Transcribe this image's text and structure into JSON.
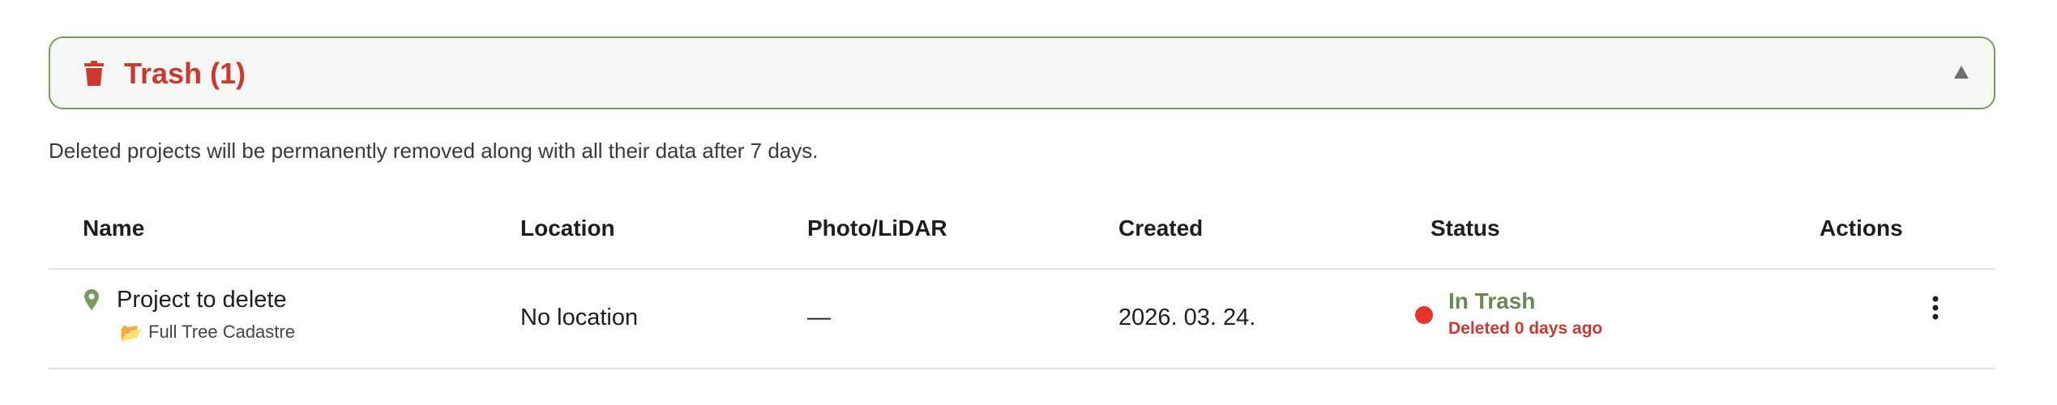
{
  "trash_section": {
    "title": "Trash (1)",
    "collapse_glyph": "▲",
    "notice": "Deleted projects will be permanently removed along with all their data after 7 days.",
    "colors": {
      "accent_red": "#c93a32",
      "border_green": "#7a9a63",
      "status_green": "#6b8756"
    },
    "icons": {
      "header": "trash-icon",
      "toggle": "collapse-icon"
    }
  },
  "table": {
    "columns": [
      "Name",
      "Location",
      "Photo/LiDAR",
      "Created",
      "Status",
      "Actions"
    ],
    "rows": [
      {
        "name": "Project to delete",
        "project_type_icon": "📂",
        "project_type": "Full Tree Cadastre",
        "location": "No location",
        "photo_lidar": "—",
        "created": "2026. 03. 24.",
        "status": "In Trash",
        "status_detail": "Deleted 0 days ago",
        "status_color": "#e3342b",
        "action_icon": "more-vertical-icon",
        "pin_icon": "location-pin-icon"
      }
    ]
  }
}
